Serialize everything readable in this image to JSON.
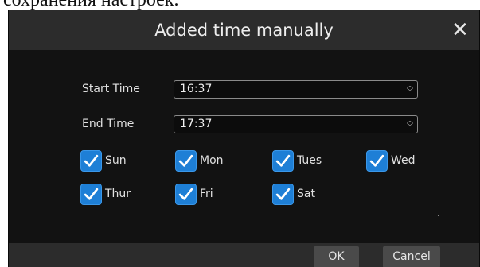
{
  "background_text": "сохранения настроек.",
  "dialog": {
    "title": "Added time manually",
    "close_glyph": "✕",
    "start_time_label": "Start Time",
    "start_time_value": "16:37",
    "end_time_label": "End Time",
    "end_time_value": "17:37",
    "spinner_up": "︿",
    "spinner_down": "﹀",
    "days": [
      {
        "label": "Sun",
        "checked": true
      },
      {
        "label": "Mon",
        "checked": true
      },
      {
        "label": "Tues",
        "checked": true
      },
      {
        "label": "Wed",
        "checked": true
      },
      {
        "label": "Thur",
        "checked": true
      },
      {
        "label": "Fri",
        "checked": true
      },
      {
        "label": "Sat",
        "checked": true
      }
    ],
    "ok_label": "OK",
    "cancel_label": "Cancel"
  },
  "colors": {
    "dialog_bg": "#121212",
    "titlebar_bg": "#2c2c2c",
    "checkbox_accent": "#1e7fd6",
    "button_bg": "#4a4a4a"
  },
  "icons": {
    "close": "close-icon",
    "checkbox": "checkmark-icon",
    "spinner": "spinner-arrows-icon"
  }
}
